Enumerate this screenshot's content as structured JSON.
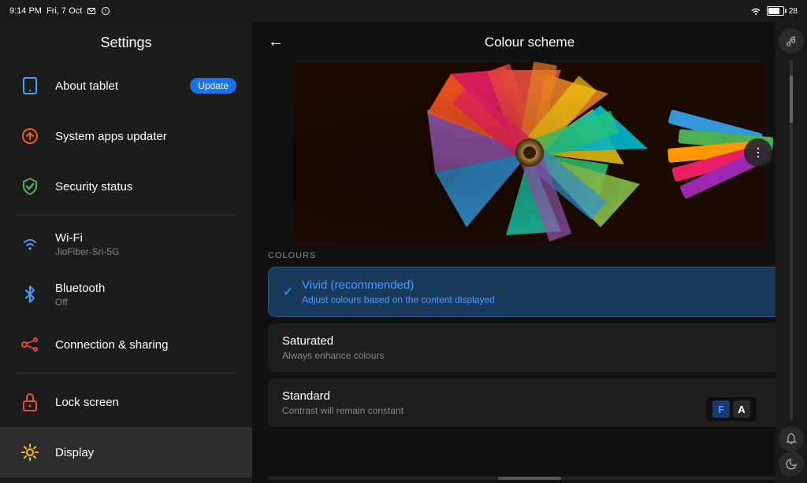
{
  "statusBar": {
    "time": "9:14 PM",
    "date": "Fri, 7 Oct",
    "battery": "28"
  },
  "sidebar": {
    "title": "Settings",
    "items": [
      {
        "id": "about-tablet",
        "title": "About tablet",
        "subtitle": "",
        "badge": "Update",
        "icon": "tablet"
      },
      {
        "id": "system-apps-updater",
        "title": "System apps updater",
        "subtitle": "",
        "badge": "",
        "icon": "update-arrow"
      },
      {
        "id": "security-status",
        "title": "Security status",
        "subtitle": "",
        "badge": "",
        "icon": "shield-check"
      },
      {
        "id": "wifi",
        "title": "Wi-Fi",
        "subtitle": "JioFiber-Sri-5G",
        "badge": "",
        "icon": "wifi"
      },
      {
        "id": "bluetooth",
        "title": "Bluetooth",
        "subtitle": "Off",
        "badge": "",
        "icon": "bluetooth"
      },
      {
        "id": "connection-sharing",
        "title": "Connection & sharing",
        "subtitle": "",
        "badge": "",
        "icon": "connection"
      },
      {
        "id": "lock-screen",
        "title": "Lock screen",
        "subtitle": "",
        "badge": "",
        "icon": "lock"
      },
      {
        "id": "display",
        "title": "Display",
        "subtitle": "",
        "badge": "",
        "icon": "sun",
        "active": true
      }
    ]
  },
  "rightPanel": {
    "title": "Colour scheme",
    "backLabel": "←",
    "coloursLabel": "COLOURS",
    "options": [
      {
        "id": "vivid",
        "title": "Vivid (recommended)",
        "subtitle": "Adjust colours based on the content displayed",
        "selected": true
      },
      {
        "id": "saturated",
        "title": "Saturated",
        "subtitle": "Always enhance colours",
        "selected": false
      },
      {
        "id": "standard",
        "title": "Standard",
        "subtitle": "Contrast will remain constant",
        "selected": false
      }
    ]
  },
  "watermark": {
    "f": "F",
    "a": "A"
  }
}
